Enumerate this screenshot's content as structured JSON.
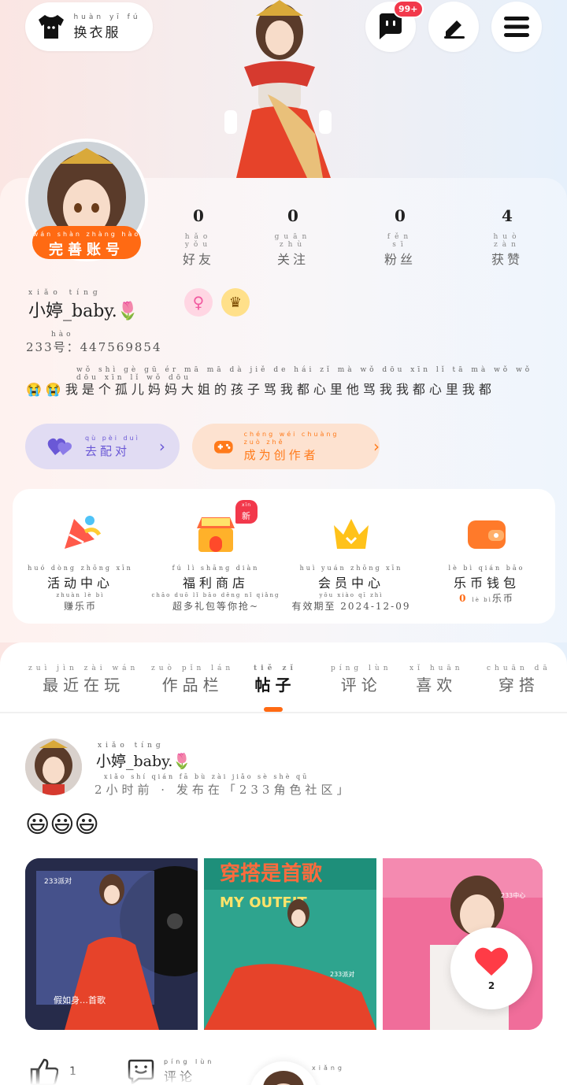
{
  "header": {
    "outfit_button": {
      "pinyin": "huàn yī fú",
      "label": "换衣服"
    },
    "message_badge": "99+"
  },
  "profile": {
    "complete_button": {
      "pinyin": "wán shàn zhàng hào",
      "label": "完善账号"
    },
    "stats": [
      {
        "value": "0",
        "pinyin": "hǎo yǒu",
        "label": "好友"
      },
      {
        "value": "0",
        "pinyin": "guān zhù",
        "label": "关注"
      },
      {
        "value": "0",
        "pinyin": "fěn sī",
        "label": "粉丝"
      },
      {
        "value": "4",
        "pinyin": "huò zàn",
        "label": "获赞"
      }
    ],
    "username_pinyin": "xiǎo tíng",
    "username": "小婷_baby.🌷",
    "id_label_pinyin": "hào",
    "id_text": "233号：447569854",
    "bio_pinyin": "wǒ shì gè gū ér mā mā dà jiě de hái zǐ mà wǒ dōu xīn lǐ tā mà wǒ wǒ dōu xīn lǐ wǒ dōu",
    "bio": "😭😭我是个孤儿妈妈大姐的孩子骂我都心里他骂我我都心里我都",
    "pair_button": {
      "pinyin": "qù pèi duì",
      "label": "去配对"
    },
    "creator_button": {
      "pinyin": "chéng wéi chuàng zuò zhě",
      "label": "成为创作者"
    }
  },
  "services": [
    {
      "pinyin": "huó dòng zhōng xīn",
      "title": "活动中心",
      "sub_pinyin": "zhuàn lè bì",
      "sub": "赚乐币",
      "icon": "party-popper-icon"
    },
    {
      "pinyin": "fú lì shāng diàn",
      "title": "福利商店",
      "sub_pinyin": "chāo duō lǐ bāo děng nǐ qiǎng",
      "sub": "超多礼包等你抢~",
      "icon": "shop-icon",
      "tag": "新",
      "tag_pinyin": "xīn"
    },
    {
      "pinyin": "huì yuán zhōng xīn",
      "title": "会员中心",
      "sub_pinyin": "yǒu xiào qī zhì",
      "sub": "有效期至 2024-12-09",
      "icon": "crown-icon"
    },
    {
      "pinyin": "lè bì qián bāo",
      "title": "乐币钱包",
      "sub_pinyin": "lè bì",
      "sub": "乐币",
      "sub_value": "0",
      "icon": "wallet-icon"
    }
  ],
  "tabs": [
    {
      "pinyin": "zuì jìn zài wán",
      "label": "最近在玩"
    },
    {
      "pinyin": "zuò pǐn lán",
      "label": "作品栏"
    },
    {
      "pinyin": "tiě zǐ",
      "label": "帖子",
      "active": true
    },
    {
      "pinyin": "píng lùn",
      "label": "评论"
    },
    {
      "pinyin": "xǐ huān",
      "label": "喜欢"
    },
    {
      "pinyin": "chuān dā",
      "label": "穿搭"
    }
  ],
  "post": {
    "author_pinyin": "xiǎo tíng",
    "author": "小婷_baby.🌷",
    "meta_pinyin": "xiǎo shí qián   fā bù zài   jiǎo sè shè qū",
    "meta": "2小时前 · 发布在「233角色社区」",
    "text": "😃😃😃",
    "image_texts": [
      "233派对",
      "假如身…首歌",
      "穿搭是首歌",
      "MY OUTFIT",
      "233派对",
      "233中心"
    ],
    "like_count": "2",
    "actions": {
      "thumb_count": "1",
      "comment_pinyin": "píng lùn",
      "comment_label": "评论",
      "share_pinyin": "xiǎng"
    }
  },
  "colors": {
    "accent": "#ff6a13",
    "pair": "#6a58d6",
    "creator": "#ff7a1a",
    "badge": "#f2384b"
  }
}
